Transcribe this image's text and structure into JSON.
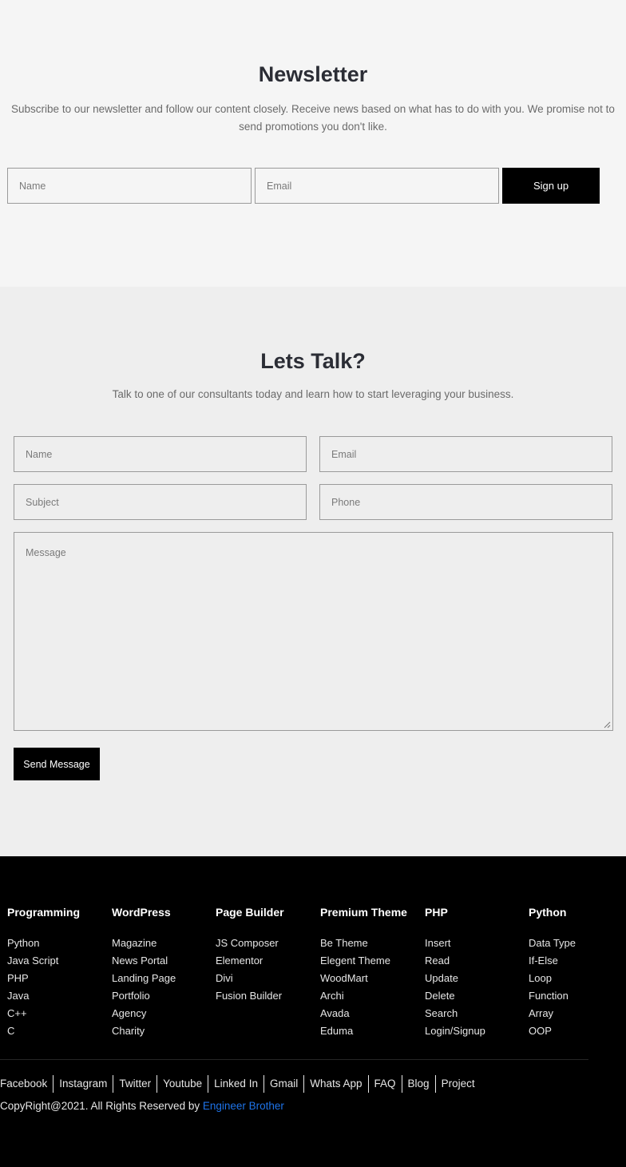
{
  "newsletter": {
    "title": "Newsletter",
    "description": "Subscribe to our newsletter and follow our content closely. Receive news based on what has to do with you. We promise not to send promotions you don't like.",
    "name_placeholder": "Name",
    "email_placeholder": "Email",
    "button": "Sign up"
  },
  "contact": {
    "title": "Lets Talk?",
    "description": "Talk to one of our consultants today and learn how to start leveraging your business.",
    "name_placeholder": "Name",
    "email_placeholder": "Email",
    "subject_placeholder": "Subject",
    "phone_placeholder": "Phone",
    "message_placeholder": "Message",
    "button": "Send Message"
  },
  "footer": {
    "columns": [
      {
        "heading": "Programming",
        "items": [
          "Python",
          "Java Script",
          "PHP",
          "Java",
          "C++",
          "C"
        ]
      },
      {
        "heading": "WordPress",
        "items": [
          "Magazine",
          "News Portal",
          "Landing Page",
          "Portfolio",
          "Agency",
          "Charity"
        ]
      },
      {
        "heading": "Page Builder",
        "items": [
          "JS Composer",
          "Elementor",
          "Divi",
          "Fusion Builder"
        ]
      },
      {
        "heading": "Premium Theme",
        "items": [
          "Be Theme",
          "Elegent Theme",
          "WoodMart",
          "Archi",
          "Avada",
          "Eduma"
        ]
      },
      {
        "heading": "PHP",
        "items": [
          "Insert",
          "Read",
          "Update",
          "Delete",
          "Search",
          "Login/Signup"
        ]
      },
      {
        "heading": "Python",
        "items": [
          "Data Type",
          "If-Else",
          "Loop",
          "Function",
          "Array",
          "OOP"
        ]
      }
    ],
    "links": [
      "Facebook",
      "Instagram",
      "Twitter",
      "Youtube",
      "Linked In",
      "Gmail",
      "Whats App",
      "FAQ",
      "Blog",
      "Project"
    ],
    "copyright": "CopyRight@2021. All Rights Reserved by",
    "brand": "Engineer Brother"
  },
  "colors": {
    "button_bg": "#000000",
    "link_accent": "#1e73e8",
    "newsletter_bg": "#f5f5f5",
    "contact_bg": "#eeeeee"
  }
}
